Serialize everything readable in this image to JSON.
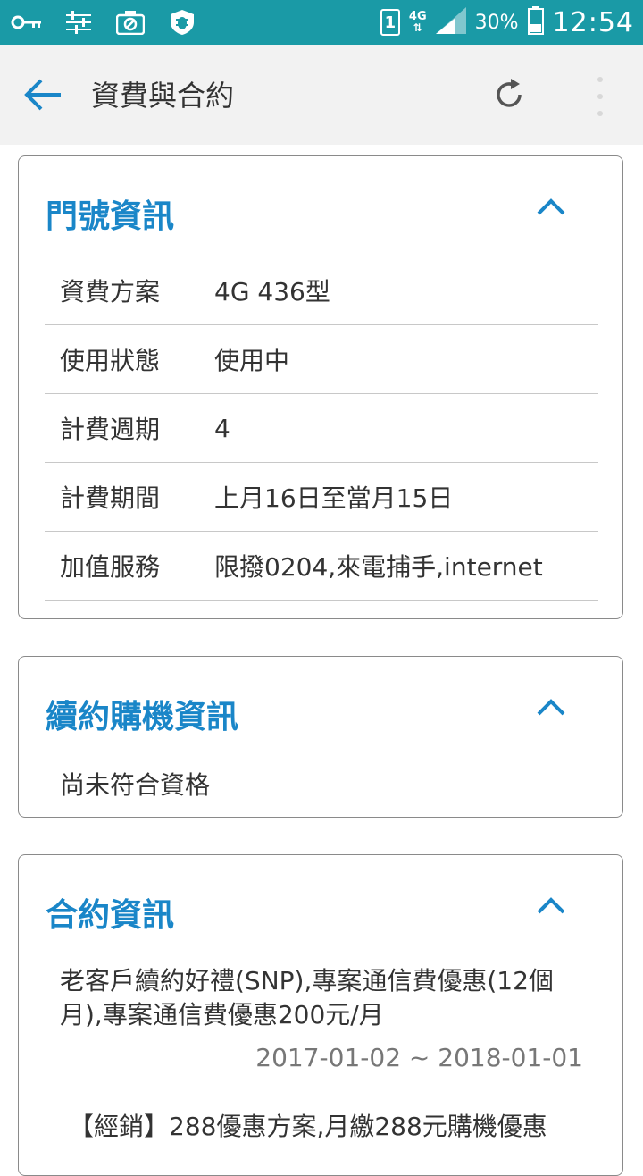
{
  "status_bar": {
    "network": "4G",
    "battery": "30%",
    "time": "12:54",
    "sim": "1"
  },
  "app_bar": {
    "title": "資費與合約"
  },
  "line_info": {
    "title": "門號資訊",
    "rows": [
      {
        "label": "資費方案",
        "value": "4G 436型"
      },
      {
        "label": "使用狀態",
        "value": "使用中"
      },
      {
        "label": "計費週期",
        "value": "4"
      },
      {
        "label": "計費期間",
        "value": "上月16日至當月15日"
      },
      {
        "label": "加值服務",
        "value": "限撥0204,來電捕手,internet"
      }
    ]
  },
  "renewal_info": {
    "title": "續約購機資訊",
    "text": "尚未符合資格"
  },
  "contract_info": {
    "title": "合約資訊",
    "items": [
      {
        "text": "老客戶續約好禮(SNP),專案通信費優惠(12個月),專案通信費優惠200元/月",
        "date": "2017-01-02 ~ 2018-01-01"
      },
      {
        "text": "【經銷】288優惠方案,月繳288元購機優惠"
      }
    ]
  },
  "colors": {
    "status_bar": "#1a9aa6",
    "app_bar": "#f2f2f2",
    "accent": "#1a86c8"
  }
}
